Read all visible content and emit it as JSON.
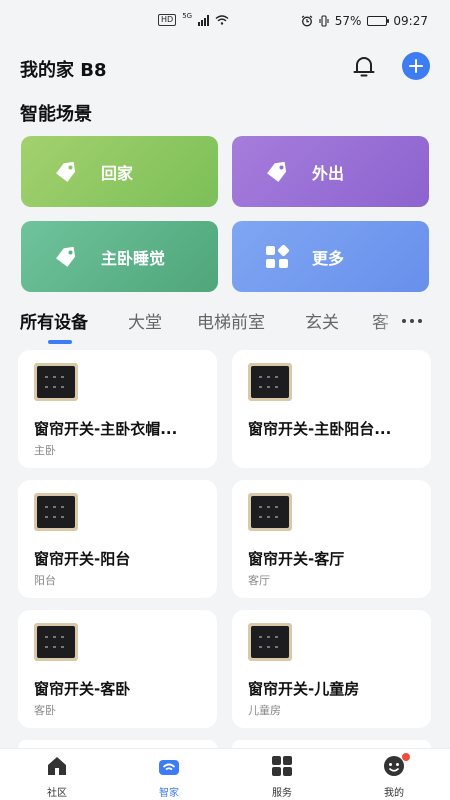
{
  "status_bar": {
    "hd": "HD",
    "net": "5G",
    "battery": "57%",
    "battery_level": 0.57,
    "time": "09:27"
  },
  "header": {
    "title": "我的家 B8"
  },
  "scenes": {
    "title": "智能场景",
    "items": [
      {
        "label": "回家",
        "icon": "tag-icon"
      },
      {
        "label": "外出",
        "icon": "tag-icon"
      },
      {
        "label": "主卧睡觉",
        "icon": "tag-icon"
      },
      {
        "label": "更多",
        "icon": "grid-shapes-icon"
      }
    ]
  },
  "tabs": [
    "所有设备",
    "大堂",
    "电梯前室",
    "玄关",
    "客"
  ],
  "devices": [
    {
      "name": "窗帘开关-主卧衣帽...",
      "room": "主卧"
    },
    {
      "name": "窗帘开关-主卧阳台...",
      "room": ""
    },
    {
      "name": "窗帘开关-阳台",
      "room": "阳台"
    },
    {
      "name": "窗帘开关-客厅",
      "room": "客厅"
    },
    {
      "name": "窗帘开关-客卧",
      "room": "客卧"
    },
    {
      "name": "窗帘开关-儿童房",
      "room": "儿童房"
    }
  ],
  "bottom_nav": [
    {
      "label": "社区",
      "icon": "home-icon"
    },
    {
      "label": "智家",
      "icon": "smart-home-wifi-icon"
    },
    {
      "label": "服务",
      "icon": "grid-icon"
    },
    {
      "label": "我的",
      "icon": "profile-face-icon"
    }
  ],
  "colors": {
    "accent": "#3d7cf2",
    "badge": "#f04b3c"
  }
}
